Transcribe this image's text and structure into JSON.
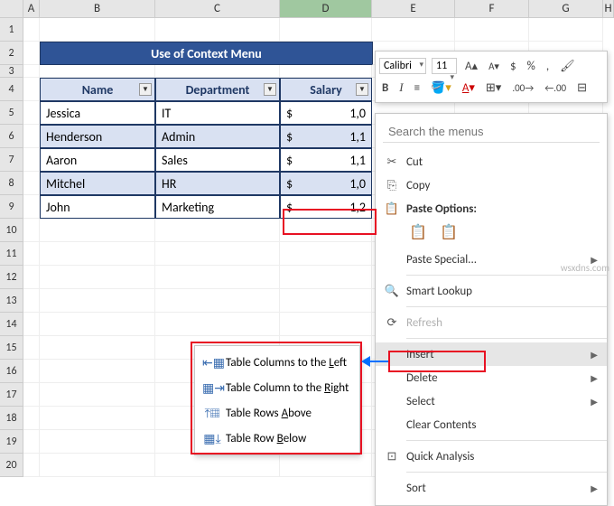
{
  "columns": [
    "A",
    "B",
    "C",
    "D",
    "E",
    "F",
    "G",
    "H"
  ],
  "rows": [
    1,
    2,
    3,
    4,
    5,
    6,
    7,
    8,
    9,
    10,
    11,
    12,
    13,
    14,
    15,
    16,
    17,
    18,
    19,
    20
  ],
  "title": "Use of Context Menu",
  "headers": {
    "name": "Name",
    "dept": "Department",
    "salary": "Salary"
  },
  "data": [
    {
      "name": "Jessica",
      "dept": "IT",
      "cur": "$",
      "sal": "1,0"
    },
    {
      "name": "Henderson",
      "dept": "Admin",
      "cur": "$",
      "sal": "1,1"
    },
    {
      "name": "Aaron",
      "dept": "Sales",
      "cur": "$",
      "sal": "1,1"
    },
    {
      "name": "Mitchel",
      "dept": "HR",
      "cur": "$",
      "sal": "1,0"
    },
    {
      "name": "John",
      "dept": "Marketing",
      "cur": "$",
      "sal": "1,2"
    }
  ],
  "miniToolbar": {
    "font": "Calibri",
    "size": "11"
  },
  "ctx": {
    "searchPlaceholder": "Search the menus",
    "cut": "Cut",
    "copy": "Copy",
    "pasteOptions": "Paste Options:",
    "pasteSpecial": "Paste Special...",
    "smartLookup": "Smart Lookup",
    "refresh": "Refresh",
    "insert": "Insert",
    "delete": "Delete",
    "select": "Select",
    "clearContents": "Clear Contents",
    "quickAnalysis": "Quick Analysis",
    "sort": "Sort"
  },
  "submenu": {
    "colsLeft_pre": "Table Columns to the ",
    "colsLeft_u": "L",
    "colsLeft_post": "eft",
    "colRight_pre": "Table Column to the ",
    "colRight_u": "R",
    "colRight_post": "ight",
    "rowsAbove_pre": "Table Rows ",
    "rowsAbove_u": "A",
    "rowsAbove_post": "bove",
    "rowBelow_pre": "Table Row ",
    "rowBelow_u": "B",
    "rowBelow_post": "elow"
  },
  "watermark": "wsxdns.com"
}
